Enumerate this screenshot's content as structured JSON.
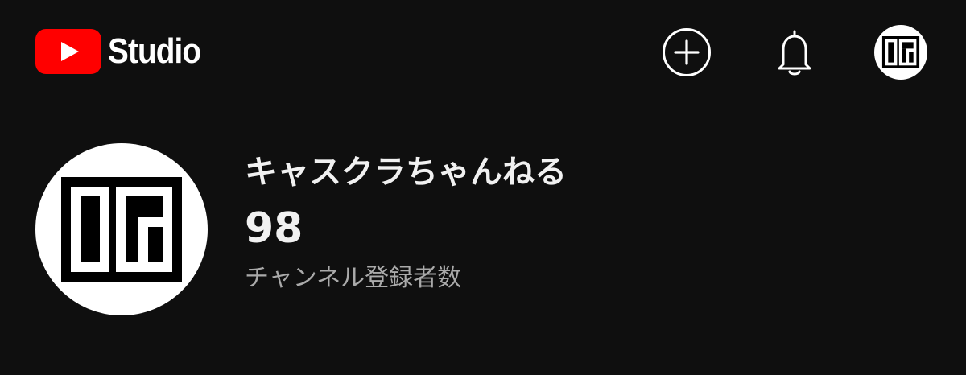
{
  "header": {
    "logo_text": "Studio",
    "brand_color": "#ff0000",
    "actions": {
      "create_icon": "plus-circle-icon",
      "notifications_icon": "bell-icon",
      "account_icon": "channel-avatar"
    }
  },
  "channel": {
    "name": "キャスクラちゃんねる",
    "subscriber_count": "98",
    "subscriber_label": "チャンネル登録者数"
  },
  "colors": {
    "background": "#0f0f0f",
    "primary_text": "#f1f1f1",
    "secondary_text": "#aaaaaa"
  }
}
